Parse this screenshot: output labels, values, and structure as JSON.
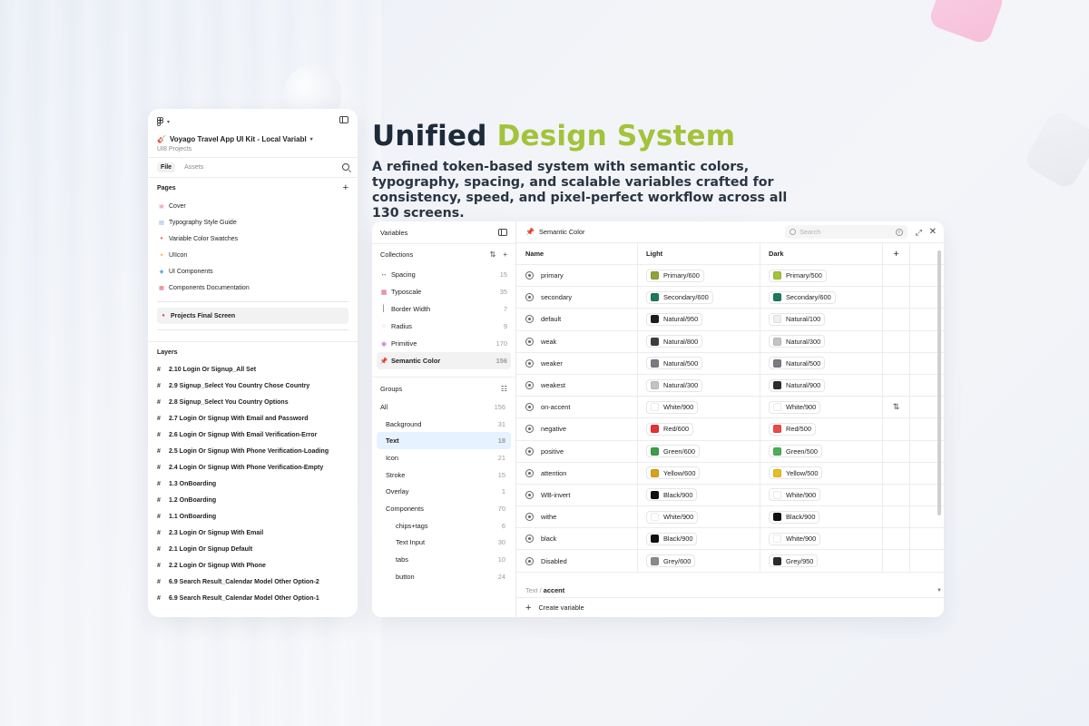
{
  "headline": {
    "part1": "Unified",
    "part2": "Design System"
  },
  "subcopy": "A refined token-based system with semantic colors, typography, spacing, and scalable variables crafted for consistency, speed, and pixel-perfect workflow across all 130 screens.",
  "left_panel": {
    "file_title": "Voyago Travel App UI Kit - Local Variabl",
    "file_subtitle": "UI8 Projects",
    "tabs": [
      "File",
      "Assets"
    ],
    "pages_label": "Pages",
    "pages": [
      {
        "label": "Cover",
        "icon": "cover-icon",
        "color": "#f3a6b8"
      },
      {
        "label": "Typography Style Guide",
        "icon": "typography-icon",
        "color": "#7aa7e8"
      },
      {
        "label": "Variable Color Swatches",
        "icon": "palette-icon",
        "color": "#e87a8a"
      },
      {
        "label": "UIIcon",
        "icon": "sparkle-icon",
        "color": "#f0c040"
      },
      {
        "label": "UI Components",
        "icon": "diamond-icon",
        "color": "#5ab0f0"
      },
      {
        "label": "Components Documentation",
        "icon": "doc-icon",
        "color": "#e86070"
      }
    ],
    "current_page": "Projects Final Screen",
    "layers_label": "Layers",
    "layers": [
      "2.10 Login Or Signup_All Set",
      "2.9 Signup_Select You Country Chose Country",
      "2.8 Signup_Select You Country Options",
      "2.7 Login Or Signup With Email and Password",
      "2.6 Login Or Signup With Email Verification-Error",
      "2.5 Login Or Signup With Phone Verification-Loading",
      "2.4 Login Or Signup With Phone Verification-Empty",
      "1.3 OnBoarding",
      "1.2 OnBoarding",
      "1.1 OnBoarding",
      "2.3 Login Or Signup With Email",
      "2.1 Login Or Signup Default",
      "2.2 Login Or Signup With Phone",
      "6.9 Search Result_Calendar Model Other Option-2",
      "6.9 Search Result_Calendar Model Other Option-1"
    ]
  },
  "variables": {
    "title": "Variables",
    "collections_label": "Collections",
    "collections": [
      {
        "label": "Spacing",
        "count": "15",
        "icon": "arrows-horizontal-icon"
      },
      {
        "label": "Typoscale",
        "count": "35",
        "icon": "typescale-icon"
      },
      {
        "label": "Border Width",
        "count": "7",
        "icon": "border-width-icon"
      },
      {
        "label": "Radius",
        "count": "9",
        "icon": "radius-icon"
      },
      {
        "label": "Primitive",
        "count": "170",
        "icon": "primitive-icon"
      },
      {
        "label": "Semantic Color",
        "count": "156",
        "icon": "pin-icon"
      }
    ],
    "groups_label": "Groups",
    "groups": [
      {
        "label": "All",
        "count": "156",
        "level": 0
      },
      {
        "label": "Background",
        "count": "31",
        "level": 1
      },
      {
        "label": "Text",
        "count": "18",
        "level": 1,
        "active": true
      },
      {
        "label": "Icon",
        "count": "21",
        "level": 1
      },
      {
        "label": "Stroke",
        "count": "15",
        "level": 1
      },
      {
        "label": "Overlay",
        "count": "1",
        "level": 1
      },
      {
        "label": "Components",
        "count": "70",
        "level": 1
      },
      {
        "label": "chips+tags",
        "count": "6",
        "level": 2
      },
      {
        "label": "Text Input",
        "count": "30",
        "level": 2
      },
      {
        "label": "tabs",
        "count": "10",
        "level": 2
      },
      {
        "label": "button",
        "count": "24",
        "level": 2
      }
    ],
    "panel_title": "Semantic Color",
    "search_placeholder": "Search",
    "columns": [
      "Name",
      "Light",
      "Dark"
    ],
    "rows": [
      {
        "name": "primary",
        "light": "Primary/600",
        "light_color": "#8ea43a",
        "dark": "Primary/500",
        "dark_color": "#a2c33a"
      },
      {
        "name": "secondary",
        "light": "Secondary/600",
        "light_color": "#1c7a5a",
        "dark": "Secondary/600",
        "dark_color": "#1c7a5a"
      },
      {
        "name": "default",
        "light": "Natural/950",
        "light_color": "#1e1e1e",
        "dark": "Natural/100",
        "dark_color": "#f0f0f0"
      },
      {
        "name": "weak",
        "light": "Natural/800",
        "light_color": "#3e3e42",
        "dark": "Natural/300",
        "dark_color": "#c4c4c6"
      },
      {
        "name": "weaker",
        "light": "Natural/500",
        "light_color": "#7a7b80",
        "dark": "Natural/500",
        "dark_color": "#7a7b80"
      },
      {
        "name": "weakest",
        "light": "Natural/300",
        "light_color": "#c4c4c6",
        "dark": "Natural/900",
        "dark_color": "#2e2e30"
      },
      {
        "name": "on-accent",
        "light": "White/900",
        "light_color": "#ffffff",
        "dark": "White/900",
        "dark_color": "#ffffff"
      },
      {
        "name": "negative",
        "light": "Red/600",
        "light_color": "#e23434",
        "dark": "Red/500",
        "dark_color": "#ea4a4a"
      },
      {
        "name": "positive",
        "light": "Green/600",
        "light_color": "#3f9c4a",
        "dark": "Green/500",
        "dark_color": "#4fae58"
      },
      {
        "name": "attention",
        "light": "Yellow/600",
        "light_color": "#d4a21c",
        "dark": "Yellow/500",
        "dark_color": "#e6bd24"
      },
      {
        "name": "WB-invert",
        "light": "Black/900",
        "light_color": "#111111",
        "dark": "White/900",
        "dark_color": "#ffffff"
      },
      {
        "name": "withe",
        "light": "White/900",
        "light_color": "#ffffff",
        "dark": "Black/900",
        "dark_color": "#111111"
      },
      {
        "name": "black",
        "light": "Black/900",
        "light_color": "#111111",
        "dark": "White/900",
        "dark_color": "#ffffff"
      },
      {
        "name": "Disabled",
        "light": "Grey/600",
        "light_color": "#8a8a8a",
        "dark": "Grey/950",
        "dark_color": "#2b2b2b"
      }
    ],
    "group_path_prefix": "Text /",
    "group_path_current": "accent",
    "create_label": "Create variable"
  },
  "colors": {
    "accent": "#a2c33a",
    "heading": "#1d2a3a"
  }
}
